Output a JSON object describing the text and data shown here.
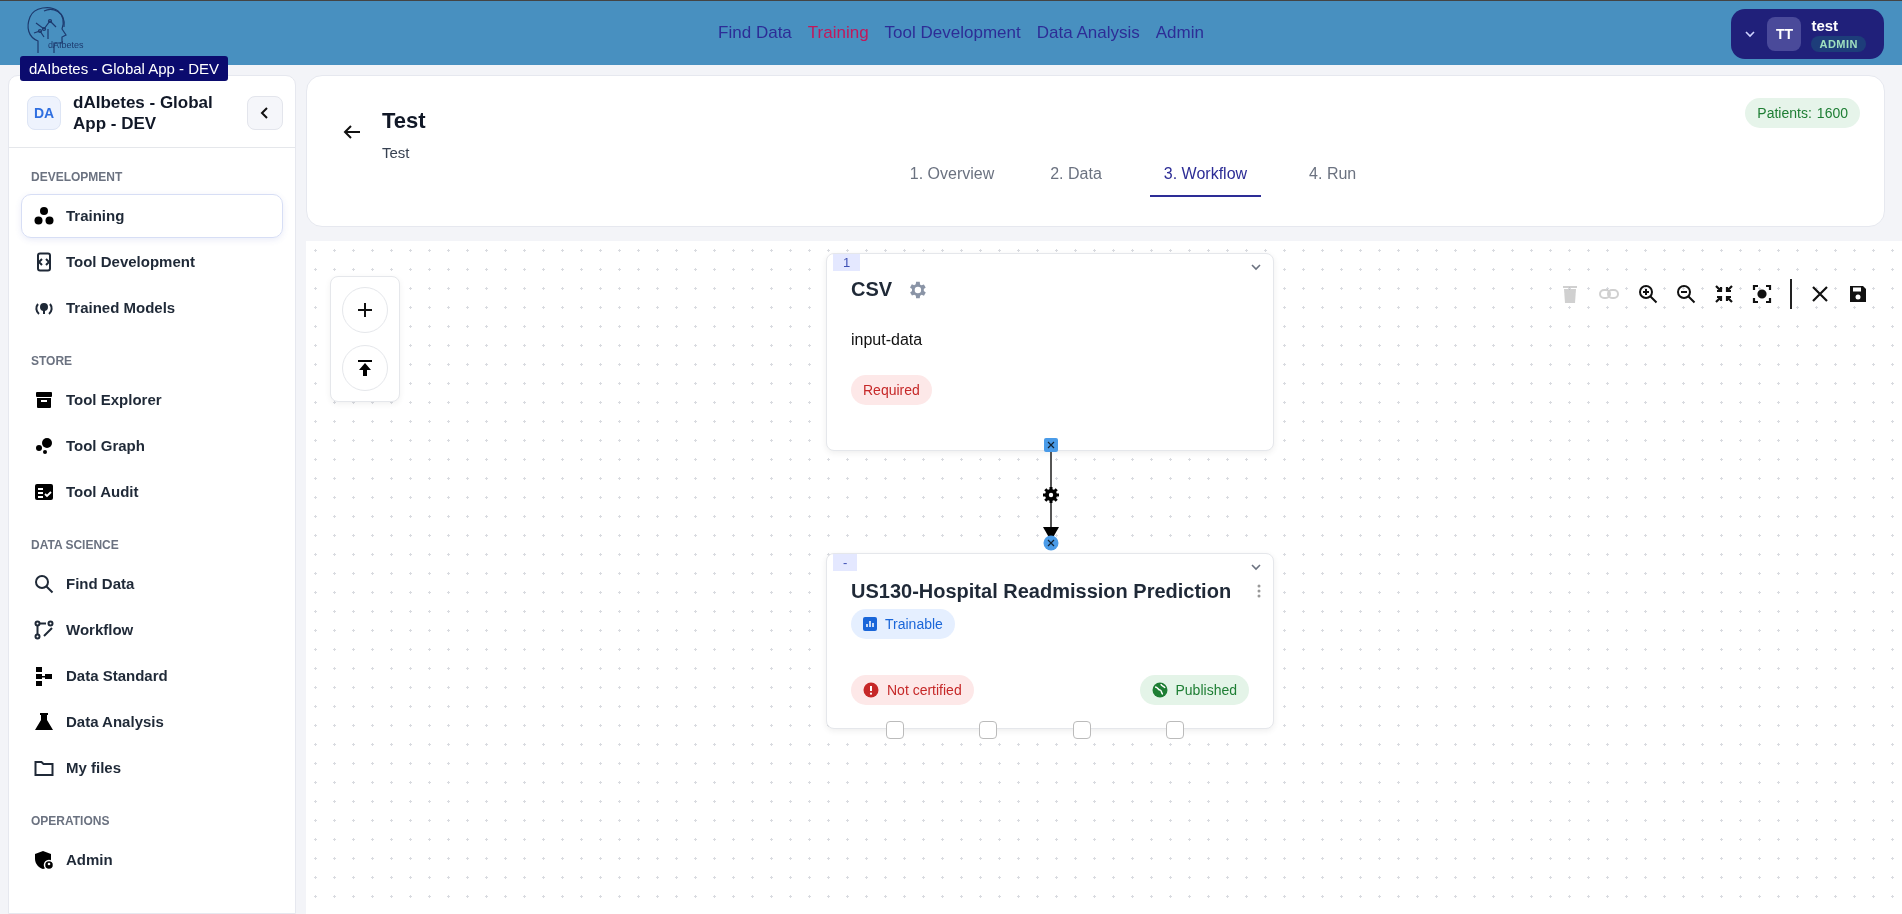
{
  "topbar": {
    "logo_text": "dAIbetes",
    "tooltip": "dAIbetes - Global App - DEV",
    "nav": [
      {
        "label": "Find Data",
        "selected": false
      },
      {
        "label": "Training",
        "selected": true
      },
      {
        "label": "Tool Development",
        "selected": false
      },
      {
        "label": "Data Analysis",
        "selected": false
      },
      {
        "label": "Admin",
        "selected": false
      }
    ],
    "user": {
      "initials": "TT",
      "name": "test",
      "role": "ADMIN"
    }
  },
  "sidebar": {
    "badge": "DA",
    "title": "dAIbetes - Global App - DEV",
    "sections": [
      {
        "title": "DEVELOPMENT",
        "items": [
          {
            "label": "Training",
            "selected": true
          },
          {
            "label": "Tool Development",
            "selected": false
          },
          {
            "label": "Trained Models",
            "selected": false
          }
        ]
      },
      {
        "title": "STORE",
        "items": [
          {
            "label": "Tool Explorer",
            "selected": false
          },
          {
            "label": "Tool Graph",
            "selected": false
          },
          {
            "label": "Tool Audit",
            "selected": false
          }
        ]
      },
      {
        "title": "DATA SCIENCE",
        "items": [
          {
            "label": "Find Data",
            "selected": false
          },
          {
            "label": "Workflow",
            "selected": false
          },
          {
            "label": "Data Standard",
            "selected": false
          },
          {
            "label": "Data Analysis",
            "selected": false
          },
          {
            "label": "My files",
            "selected": false
          }
        ]
      },
      {
        "title": "OPERATIONS",
        "items": [
          {
            "label": "Admin",
            "selected": false
          }
        ]
      }
    ]
  },
  "header": {
    "title": "Test",
    "subtitle": "Test",
    "patients_label": "Patients:",
    "patients_value": "1600",
    "tabs": [
      {
        "label": "1. Overview",
        "selected": false
      },
      {
        "label": "2. Data",
        "selected": false
      },
      {
        "label": "3. Workflow",
        "selected": true
      },
      {
        "label": "4. Run",
        "selected": false
      }
    ]
  },
  "canvas": {
    "toolbar": [
      {
        "kind": "delete",
        "disabled": true
      },
      {
        "kind": "link",
        "disabled": true
      },
      {
        "kind": "zoom-in",
        "disabled": false
      },
      {
        "kind": "zoom-out",
        "disabled": false
      },
      {
        "kind": "fit",
        "disabled": false
      },
      {
        "kind": "center",
        "disabled": false
      },
      {
        "kind": "close",
        "disabled": false
      },
      {
        "kind": "save",
        "disabled": false
      }
    ],
    "nodes": [
      {
        "index": "1",
        "title": "CSV",
        "description": "input-data",
        "badges": [
          {
            "kind": "required",
            "label": "Required"
          }
        ]
      },
      {
        "index": "-",
        "title": "US130-Hospital Readmission Prediction",
        "badges": [
          {
            "kind": "trainable",
            "label": "Trainable"
          },
          {
            "kind": "not-certified",
            "label": "Not certified"
          },
          {
            "kind": "published",
            "label": "Published"
          }
        ]
      }
    ]
  }
}
